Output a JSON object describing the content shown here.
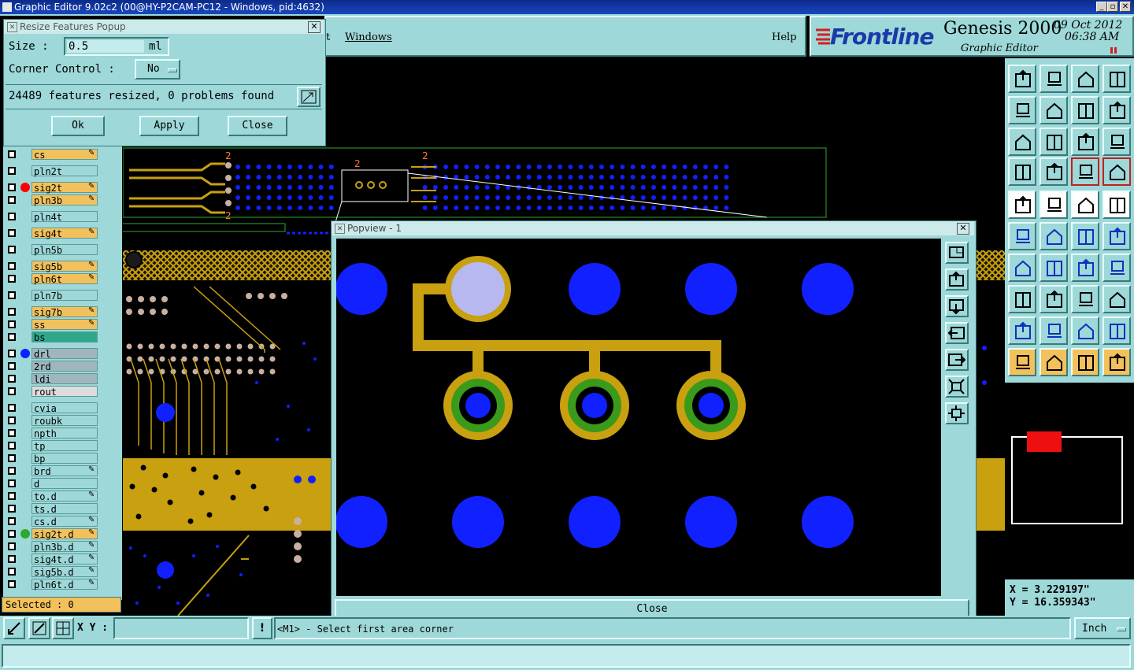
{
  "window": {
    "title": "Graphic Editor 9.02c2 (00@HY-P2CAM-PC12 - Windows, pid:4632)"
  },
  "menu": {
    "items": [
      "t",
      "Windows"
    ],
    "help": "Help"
  },
  "brand": {
    "logo": "Frontline",
    "product": "Genesis 2000",
    "subtitle": "Graphic Editor",
    "date": "09 Oct 2012",
    "time": "06:38 AM"
  },
  "resize_popup": {
    "title": "Resize Features Popup",
    "size_label": "Size :",
    "size_value": "0.5",
    "size_unit": "ml",
    "corner_label": "Corner Control :",
    "corner_value": "No",
    "status": "24489 features resized, 0 problems found",
    "ok": "Ok",
    "apply": "Apply",
    "close": "Close"
  },
  "layers": [
    {
      "name": "cs",
      "color": "#f3c15b",
      "edit": true
    },
    {
      "name": "pln2t",
      "color": "#9ed8d8",
      "edit": false
    },
    {
      "name": "sig2t",
      "color": "#f3c15b",
      "edit": true,
      "dot": "#ff0000"
    },
    {
      "name": "pln3b",
      "color": "#f3c15b",
      "edit": true
    },
    {
      "name": "pln4t",
      "color": "#9ed8d8",
      "edit": false
    },
    {
      "name": "sig4t",
      "color": "#f3c15b",
      "edit": true
    },
    {
      "name": "pln5b",
      "color": "#9ed8d8",
      "edit": false
    },
    {
      "name": "sig5b",
      "color": "#f3c15b",
      "edit": true
    },
    {
      "name": "pln6t",
      "color": "#f3c15b",
      "edit": true
    },
    {
      "name": "pln7b",
      "color": "#9ed8d8",
      "edit": false
    },
    {
      "name": "sig7b",
      "color": "#f3c15b",
      "edit": true
    },
    {
      "name": "ss",
      "color": "#f3c15b",
      "edit": true
    },
    {
      "name": "bs",
      "color": "#2fa88a",
      "edit": false
    },
    {
      "name": "drl",
      "color": "#9fb6bf",
      "edit": false,
      "dot": "#1020ff"
    },
    {
      "name": "2rd",
      "color": "#9fb6bf",
      "edit": false
    },
    {
      "name": "ldi",
      "color": "#9fb6bf",
      "edit": false
    },
    {
      "name": "rout",
      "color": "#dcdcdc",
      "edit": false
    },
    {
      "name": "cvia",
      "color": "#9ed8d8",
      "edit": false
    },
    {
      "name": "roubk",
      "color": "#9ed8d8",
      "edit": false
    },
    {
      "name": "npth",
      "color": "#9ed8d8",
      "edit": false
    },
    {
      "name": "tp",
      "color": "#9ed8d8",
      "edit": false
    },
    {
      "name": "bp",
      "color": "#9ed8d8",
      "edit": false
    },
    {
      "name": "brd",
      "color": "#9ed8d8",
      "edit": true
    },
    {
      "name": "d",
      "color": "#9ed8d8",
      "edit": false
    },
    {
      "name": "to.d",
      "color": "#9ed8d8",
      "edit": true
    },
    {
      "name": "ts.d",
      "color": "#9ed8d8",
      "edit": false
    },
    {
      "name": "cs.d",
      "color": "#9ed8d8",
      "edit": true
    },
    {
      "name": "sig2t.d",
      "color": "#f3c15b",
      "edit": true,
      "dot": "#2fa82f"
    },
    {
      "name": "pln3b.d",
      "color": "#9ed8d8",
      "edit": true
    },
    {
      "name": "sig4t.d",
      "color": "#9ed8d8",
      "edit": true
    },
    {
      "name": "sig5b.d",
      "color": "#9ed8d8",
      "edit": true
    },
    {
      "name": "pln6t.d",
      "color": "#9ed8d8",
      "edit": true
    }
  ],
  "selected": "Selected : 0",
  "popview": {
    "title": "Popview - 1",
    "close": "Close"
  },
  "board_labels": [
    "2",
    "2",
    "2",
    "2"
  ],
  "coords": {
    "x": "X = 3.229197\"",
    "y": "Y = 16.359343\""
  },
  "bottom": {
    "xy_label": "X Y :",
    "xy_value": "",
    "prompt": "<M1> - Select first area corner",
    "units": "Inch"
  },
  "colors": {
    "panel": "#9ed8d8",
    "copper": "#c8a010",
    "pad": "#1020ff",
    "gold": "#f3c15b"
  }
}
